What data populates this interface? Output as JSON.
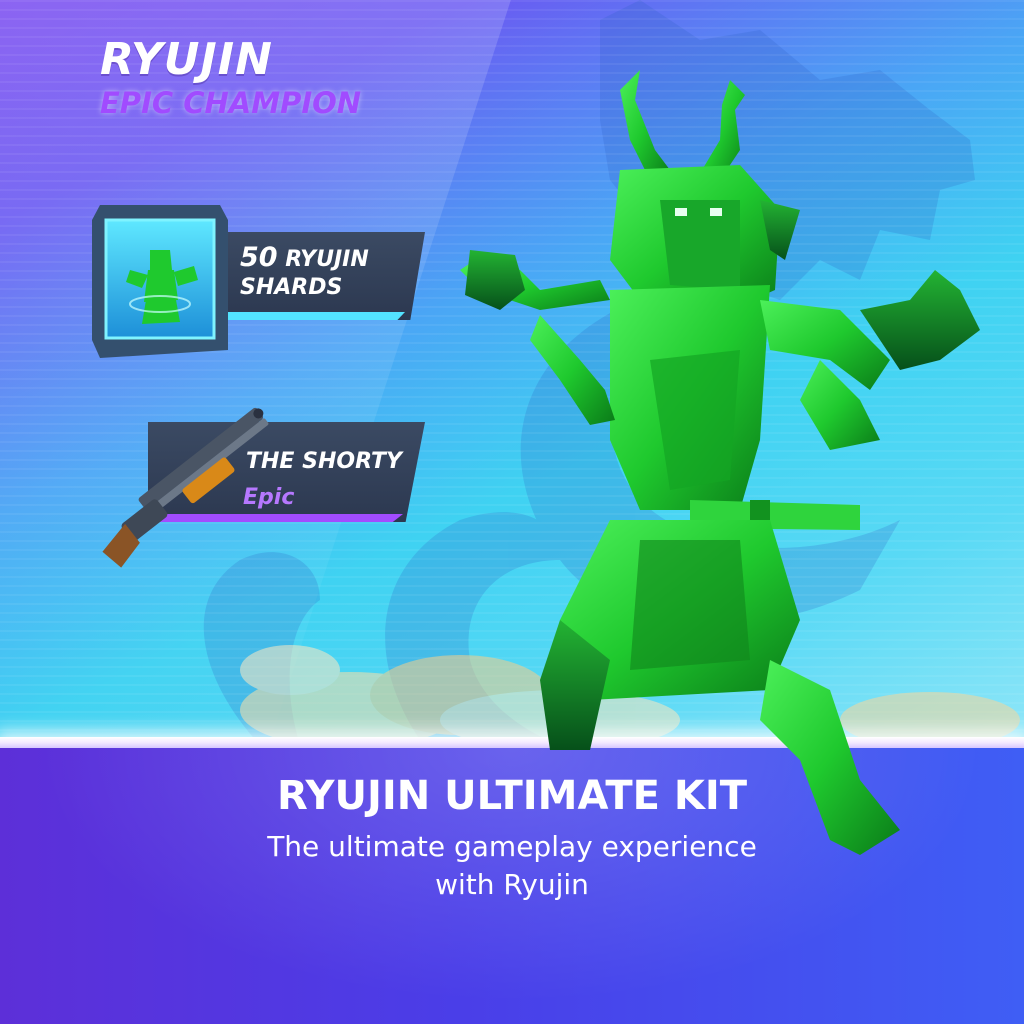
{
  "hero": {
    "name": "RYUJIN",
    "rank": "EPIC CHAMPION"
  },
  "rewards": [
    {
      "quantity": "50",
      "name": "RYUJIN",
      "line2": "SHARDS",
      "icon": "ryujin-shard-card-icon",
      "accent": "#53e3ff"
    },
    {
      "name": "THE SHORTY",
      "rarity": "Epic",
      "icon": "shotgun-icon",
      "accent": "#a24cff"
    }
  ],
  "kit": {
    "title": "RYUJIN ULTIMATE KIT",
    "description": "The ultimate gameplay experience with Ryujin"
  },
  "colors": {
    "rank": "#a14bff",
    "rarity_epic": "#b678ff",
    "champion": "#1fc92e",
    "bottom_panel": "#4a3ee8"
  }
}
